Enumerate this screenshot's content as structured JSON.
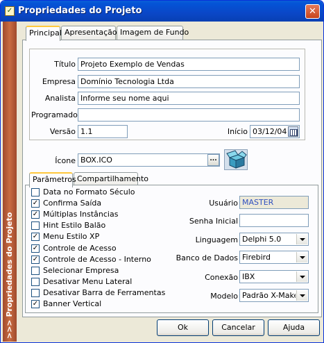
{
  "window": {
    "title": "Propriedades do Projeto",
    "close": "✕",
    "title_icon": "checkbox-icon"
  },
  "sidebar": {
    "text": ">>> Propriedades do Projeto"
  },
  "tabs": [
    "Principal",
    "Apresentação",
    "Imagem de Fundo"
  ],
  "form": {
    "titulo_label": "Título",
    "titulo_value": "Projeto Exemplo de Vendas",
    "empresa_label": "Empresa",
    "empresa_value": "Domínio Tecnologia Ltda",
    "analista_label": "Analista",
    "analista_value": "Informe seu nome aqui",
    "programador_label": "Programador",
    "programador_value": "",
    "versao_label": "Versão",
    "versao_value": "1.1",
    "inicio_label": "Início",
    "inicio_value": "03/12/04",
    "icone_label": "Ícone",
    "icone_value": "BOX.ICO",
    "browse": "..."
  },
  "subtabs": [
    "Parâmetros",
    "Compartilhamento"
  ],
  "options": [
    {
      "label": "Data no Formato Século",
      "checked": false
    },
    {
      "label": "Confirma Saída",
      "checked": true
    },
    {
      "label": "Múltiplas Instâncias",
      "checked": true
    },
    {
      "label": "Hint Estilo Balão",
      "checked": false
    },
    {
      "label": "Menu Estilo XP",
      "checked": true
    },
    {
      "label": "Controle de Acesso",
      "checked": true
    },
    {
      "label": "Controle de Acesso - Interno",
      "checked": true
    },
    {
      "label": "Selecionar Empresa",
      "checked": false
    },
    {
      "label": "Desativar Menu Lateral",
      "checked": false
    },
    {
      "label": "Desativar Barra de Ferramentas",
      "checked": false
    },
    {
      "label": "Banner Vertical",
      "checked": true
    }
  ],
  "params": {
    "usuario_label": "Usuário",
    "usuario_value": "MASTER",
    "senha_label": "Senha Inicial",
    "senha_value": "",
    "linguagem_label": "Linguagem",
    "linguagem_value": "Delphi 5.0",
    "banco_label": "Banco de Dados",
    "banco_value": "Firebird",
    "conexao_label": "Conexão",
    "conexao_value": "IBX",
    "modelo_label": "Modelo",
    "modelo_value": "Padrão X-Maker"
  },
  "buttons": {
    "ok": "Ok",
    "cancel": "Cancelar",
    "help": "Ajuda"
  },
  "colors": {
    "title_bar": "#0a47c7",
    "sidebar": "#b35a36",
    "readonly_text": "#3050c0"
  }
}
